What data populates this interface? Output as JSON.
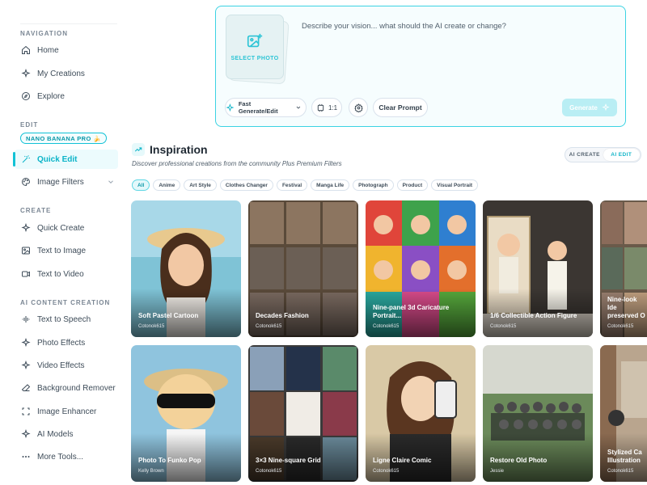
{
  "sidebar": {
    "navigation_label": "NAVIGATION",
    "navigation": [
      {
        "label": "Home",
        "icon": "home-icon"
      },
      {
        "label": "My Creations",
        "icon": "sparkles-icon"
      },
      {
        "label": "Explore",
        "icon": "compass-icon"
      }
    ],
    "edit_label": "EDIT",
    "edit_badge": "NANO BANANA PRO 🍌",
    "edit": [
      {
        "label": "Quick Edit",
        "icon": "magic-wand-icon",
        "active": true
      },
      {
        "label": "Image Filters",
        "icon": "palette-icon",
        "expandable": true
      }
    ],
    "create_label": "CREATE",
    "create": [
      {
        "label": "Quick Create",
        "icon": "sparkles-icon"
      },
      {
        "label": "Text to Image",
        "icon": "image-icon"
      },
      {
        "label": "Text to Video",
        "icon": "video-icon"
      }
    ],
    "ai_content_label": "AI CONTENT CREATION",
    "ai_content": [
      {
        "label": "Text to Speech",
        "icon": "speech-icon"
      },
      {
        "label": "Photo Effects",
        "icon": "sparkles-icon"
      },
      {
        "label": "Video Effects",
        "icon": "sparkles-icon"
      },
      {
        "label": "Background Remover",
        "icon": "eraser-icon"
      },
      {
        "label": "Image Enhancer",
        "icon": "enhance-icon"
      },
      {
        "label": "AI Models",
        "icon": "sparkles-icon"
      },
      {
        "label": "More Tools...",
        "icon": "more-dots-icon"
      }
    ]
  },
  "prompt": {
    "select_photo": "SELECT PHOTO",
    "placeholder": "Describe your vision... what should the AI create or change?",
    "mode_label": "Fast Generate/Edit",
    "ratio_label": "1:1",
    "clear_label": "Clear Prompt",
    "generate_label": "Generate"
  },
  "inspiration": {
    "title": "Inspiration",
    "subtitle": "Discover professional creations from the community Plus Premium Filters",
    "toggle": [
      "AI CREATE",
      "AI EDIT"
    ],
    "toggle_active": "AI EDIT",
    "filters": [
      "All",
      "Anime",
      "Art Style",
      "Clothes Changer",
      "Festival",
      "Manga Life",
      "Photograph",
      "Product",
      "Visual Portrait"
    ],
    "active_filter": "All",
    "cards": [
      {
        "title": "Soft Pastel Cartoon",
        "author": "Cotonok615"
      },
      {
        "title": "Decades Fashion",
        "author": "Cotonok615"
      },
      {
        "title": "Nine-panel 3d Caricature Portrait...",
        "author": "Cotonok615"
      },
      {
        "title": "1/6 Collectible Action Figure",
        "author": "Cotonok615"
      },
      {
        "title": "Nine-look Ide preserved O",
        "author": "Cotonok615"
      },
      {
        "title": "Photo To Funko Pop",
        "author": "Kelly Brown"
      },
      {
        "title": "3×3 Nine-square Grid",
        "author": "Cotonok615"
      },
      {
        "title": "Ligne Claire Comic",
        "author": "Cotonok615"
      },
      {
        "title": "Restore Old Photo",
        "author": "Jessie"
      },
      {
        "title": "Stylized Ca Illustration",
        "author": "Cotonok615"
      }
    ]
  },
  "colors": {
    "accent": "#12c2d6",
    "accent_soft": "#ecfbfd",
    "generate_disabled": "#b9eef4"
  }
}
